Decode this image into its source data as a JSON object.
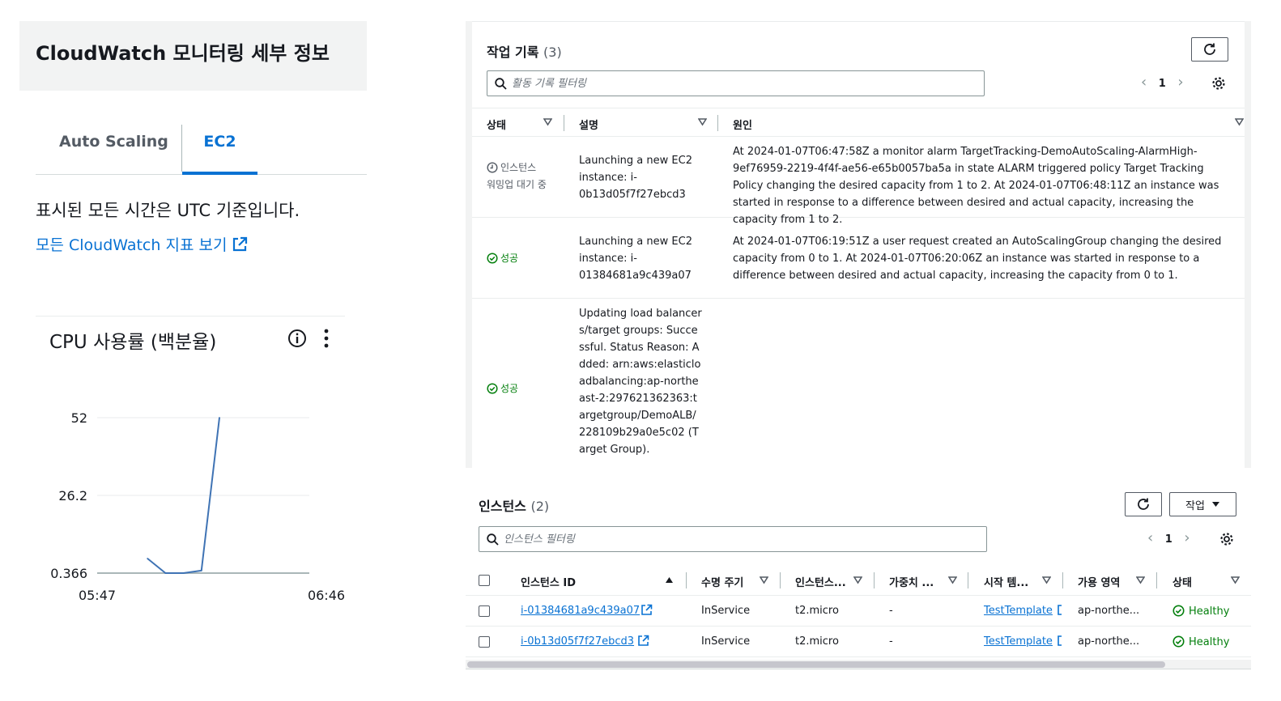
{
  "cloudwatch": {
    "title": "CloudWatch 모니터링 세부 정보",
    "tabs": [
      {
        "label": "Auto Scaling",
        "selected": false
      },
      {
        "label": "EC2",
        "selected": true
      }
    ],
    "utc_note": "표시된 모든 시간은 UTC 기준입니다.",
    "metrics_link": "모든 CloudWatch 지표 보기"
  },
  "chart_data": {
    "type": "line",
    "title": "CPU 사용률 (백분율)",
    "xlabel": "",
    "ylabel": "",
    "x_tick_labels": [
      "05:47",
      "06:46"
    ],
    "y_tick_labels": [
      "52",
      "26.2",
      "0.366"
    ],
    "ylim": [
      0.366,
      52
    ],
    "x": [
      "06:01",
      "06:06",
      "06:11",
      "06:16",
      "06:21"
    ],
    "series": [
      {
        "values": [
          5.2,
          0.366,
          0.366,
          1.2,
          52
        ],
        "color": "#3f73b4"
      }
    ],
    "grid": true,
    "legend": "none"
  },
  "activity": {
    "title": "작업 기록",
    "count": "(3)",
    "search_placeholder": "활동 기록 필터링",
    "page": "1",
    "columns": [
      "상태",
      "설명",
      "원인"
    ],
    "rows": [
      {
        "status": "인스턴스 워밍업 대기 중",
        "status_line1": "인스턴스",
        "status_line2": "워밍업 대기 중",
        "description": "Launching a new EC2 instance: i-0b13d05f7f27ebcd3",
        "cause": "At 2024-01-07T06:47:58Z a monitor alarm TargetTracking-DemoAutoScaling-AlarmHigh-9ef76959-2219-4f4f-ae56-e65b0057ba5a in state ALARM triggered policy Target Tracking Policy changing the desired capacity from 1 to 2. At 2024-01-07T06:48:11Z an instance was started in response to a difference between desired and actual capacity, increasing the capacity from 1 to 2."
      },
      {
        "status": "성공",
        "description": "Launching a new EC2 instance: i-01384681a9c439a07",
        "cause": "At 2024-01-07T06:19:51Z a user request created an AutoScalingGroup changing the desired capacity from 0 to 1. At 2024-01-07T06:20:06Z an instance was started in response to a difference between desired and actual capacity, increasing the capacity from 0 to 1."
      },
      {
        "status": "성공",
        "description": "Updating load balancers/target groups: Successful. Status Reason: Added: arn:aws:elasticloadbalancing:ap-northeast-2:297621362363:targetgroup/DemoALB/228109b29a0e5c02 (Target Group).",
        "cause": ""
      }
    ]
  },
  "instances": {
    "title": "인스턴스",
    "count": "(2)",
    "action_label": "작업",
    "search_placeholder": "인스턴스 필터링",
    "page": "1",
    "columns": [
      "인스턴스 ID",
      "수명 주기",
      "인스턴스...",
      "가중치 ...",
      "시작 템...",
      "가용 영역",
      "상태"
    ],
    "rows": [
      {
        "id": "i-01384681a9c439a07",
        "lifecycle": "InService",
        "type": "t2.micro",
        "weight": "-",
        "template": "TestTemplate",
        "az": "ap-northe...",
        "health": "Healthy"
      },
      {
        "id": "i-0b13d05f7f27ebcd3",
        "lifecycle": "InService",
        "type": "t2.micro",
        "weight": "-",
        "template": "TestTemplate",
        "az": "ap-northe...",
        "health": "Healthy"
      }
    ]
  }
}
